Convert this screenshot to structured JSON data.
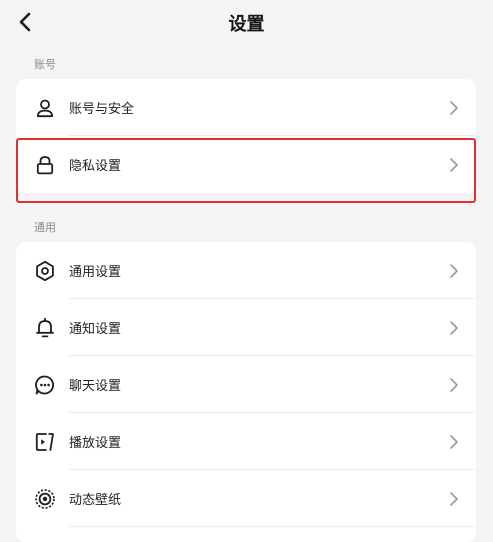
{
  "header": {
    "title": "设置"
  },
  "sections": [
    {
      "label": "账号"
    },
    {
      "label": "通用"
    }
  ],
  "account_items": [
    {
      "label": "账号与安全",
      "icon": "user-icon"
    },
    {
      "label": "隐私设置",
      "icon": "lock-icon"
    }
  ],
  "general_items": [
    {
      "label": "通用设置",
      "icon": "gear-icon"
    },
    {
      "label": "通知设置",
      "icon": "bell-icon"
    },
    {
      "label": "聊天设置",
      "icon": "chat-icon"
    },
    {
      "label": "播放设置",
      "icon": "play-icon"
    },
    {
      "label": "动态壁纸",
      "icon": "wallpaper-icon"
    }
  ],
  "colors": {
    "highlight": "#e03131",
    "background": "#f4f4f6",
    "card": "#ffffff"
  }
}
